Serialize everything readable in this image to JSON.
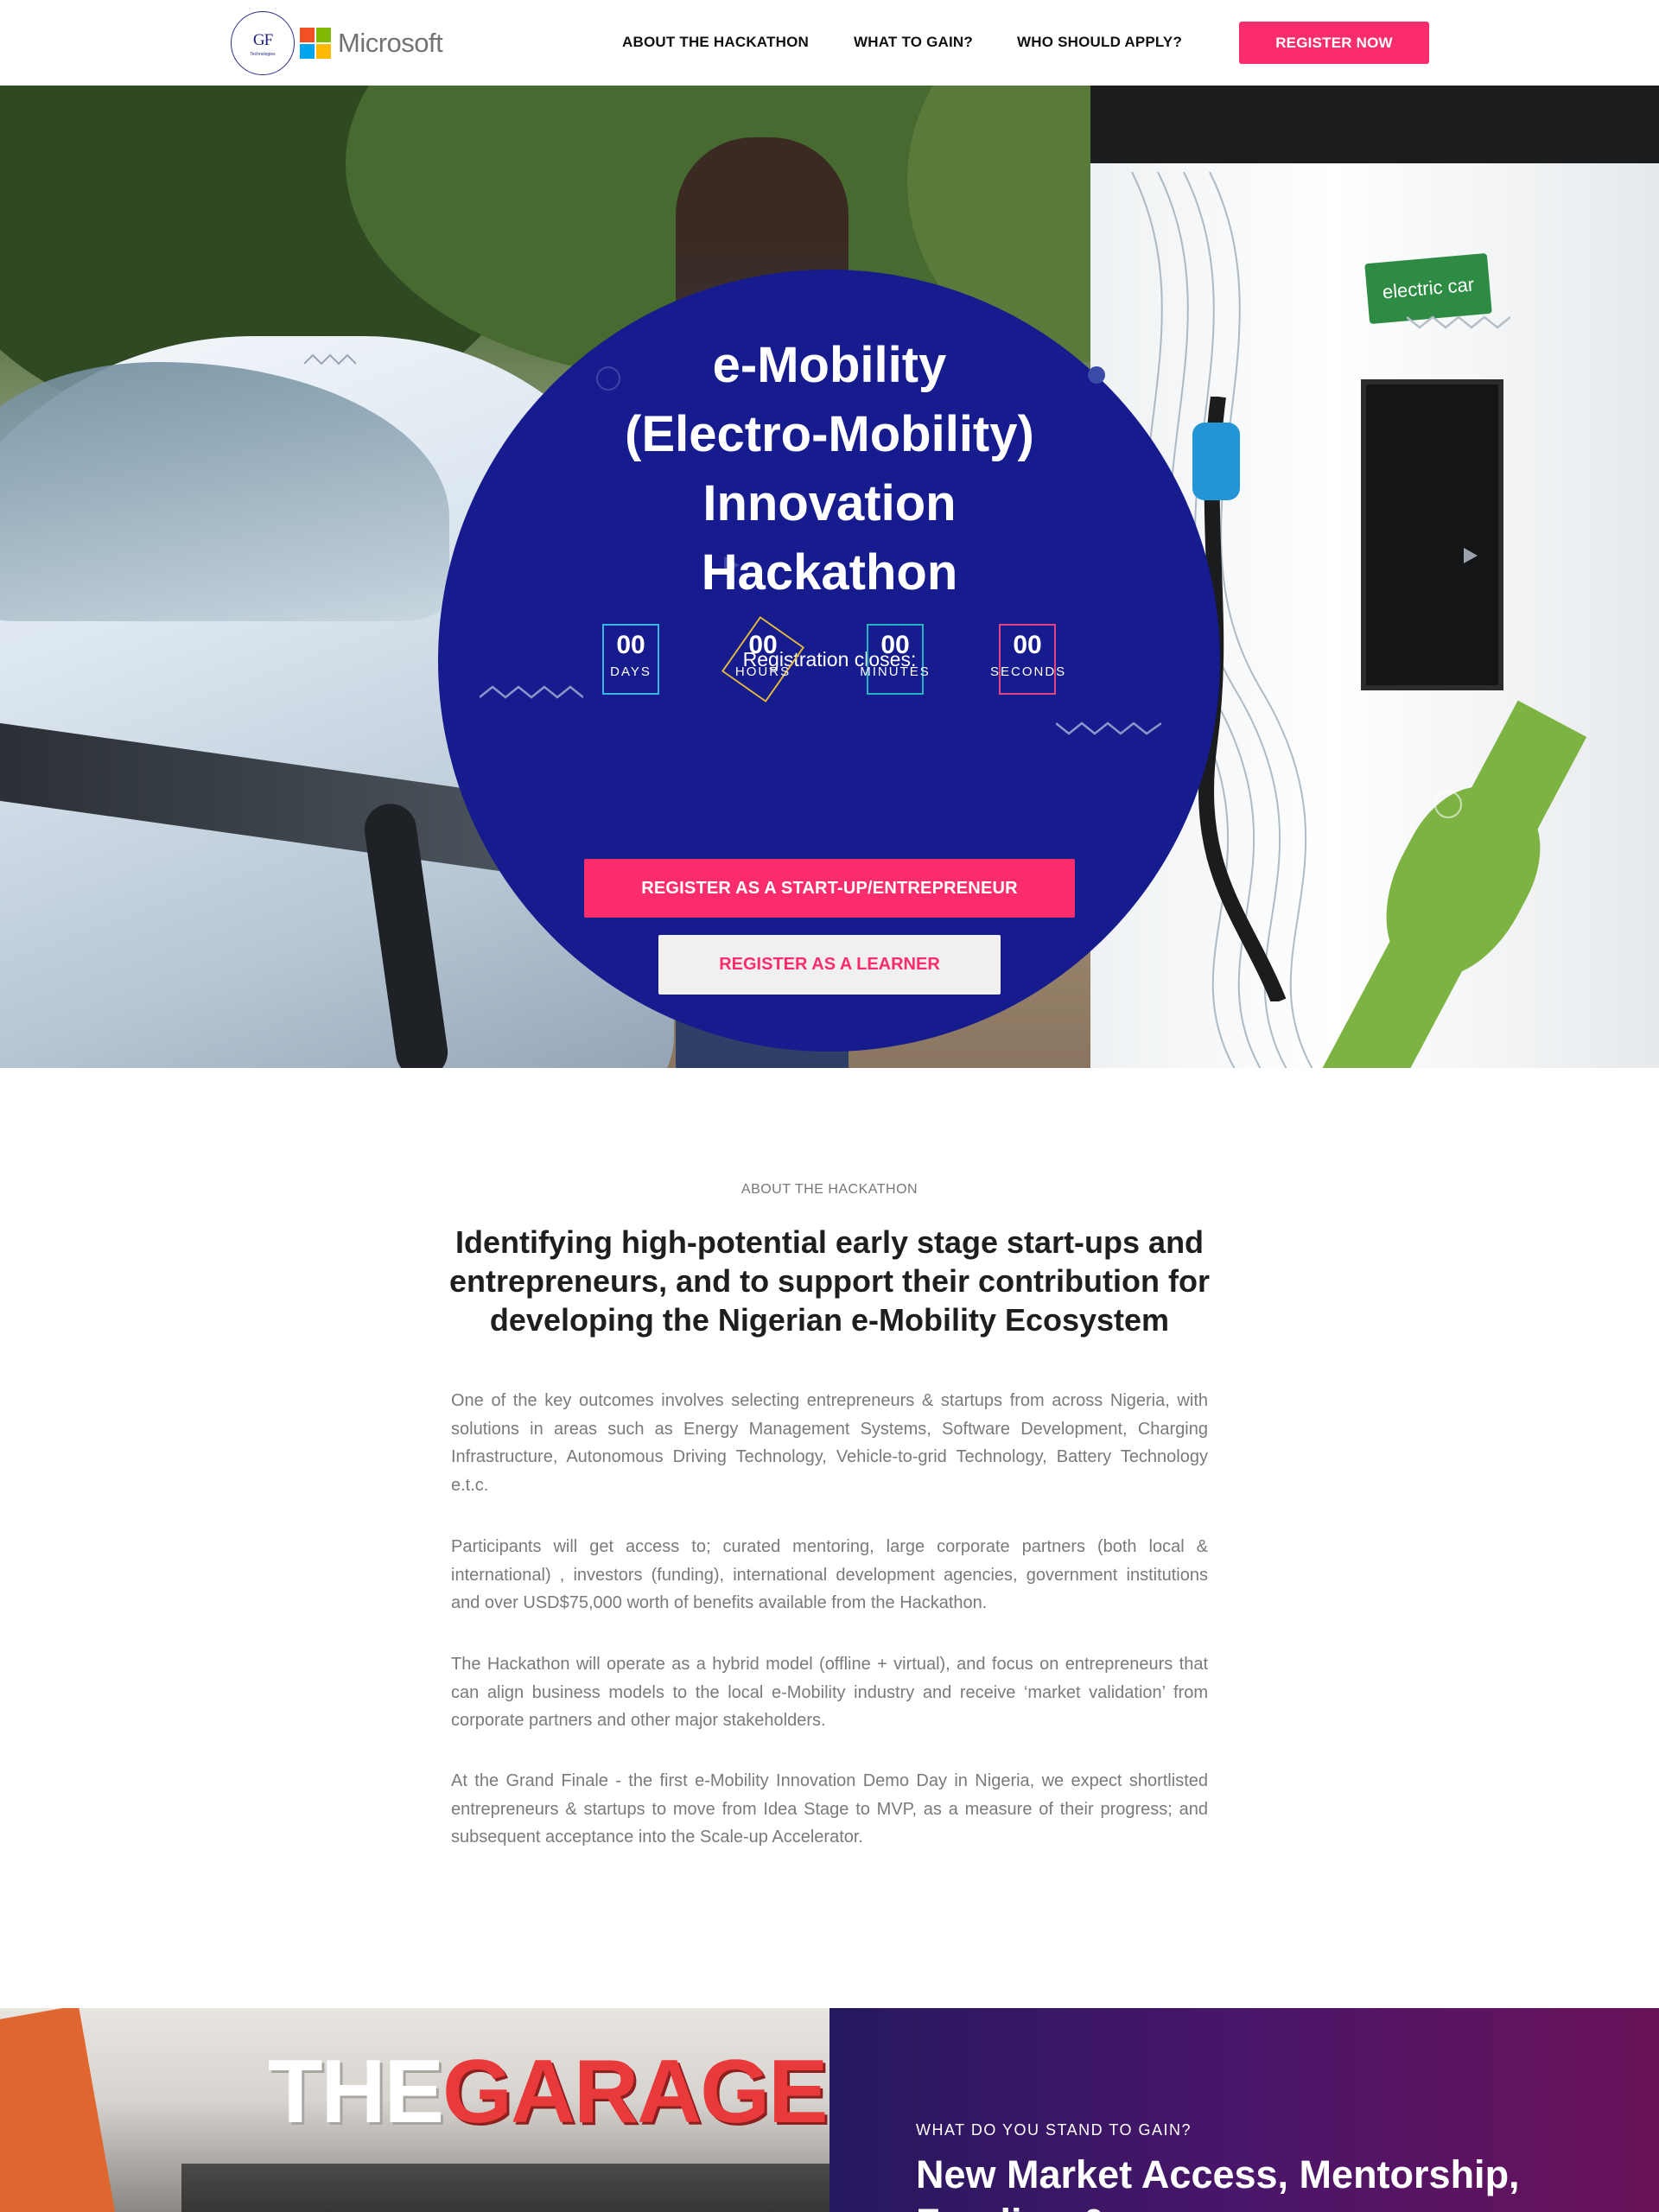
{
  "header": {
    "gf_logo_text": "GF",
    "gf_logo_sub": "Technologies",
    "microsoft_logo_text": "Microsoft",
    "nav": [
      "ABOUT THE HACKATHON",
      "WHAT TO GAIN?",
      "WHO SHOULD APPLY?"
    ],
    "register_now_label": "REGISTER NOW ",
    "accent_color": "#fb2c6b"
  },
  "hero": {
    "title_lines": [
      "e-Mobility",
      "(Electro-Mobility)",
      "Innovation",
      "Hackathon"
    ],
    "registration_label": "Registration closes:",
    "countdown": [
      {
        "value": "00",
        "label": "DAYS",
        "color": "#36b6e0"
      },
      {
        "value": "00",
        "label": "HOURS",
        "color": "#e5b93a"
      },
      {
        "value": "00",
        "label": "MINUTES",
        "color": "#22b2c0"
      },
      {
        "value": "00",
        "label": "SECONDS",
        "color": "#e3467f"
      }
    ],
    "btn_startup": "REGISTER AS A START-UP/ENTREPRENEUR",
    "btn_learner": "REGISTER AS A LEARNER",
    "background_image_badge": "electric car",
    "circle_color": "#161b8e"
  },
  "about": {
    "eyebrow": "ABOUT THE HACKATHON",
    "heading": "Identifying high-potential early stage start-ups and entrepreneurs, and to support their contribution for developing the Nigerian e-Mobility Ecosystem",
    "paragraphs": [
      "One of the key outcomes involves selecting entrepreneurs & startups from across Nigeria, with solutions in areas such as Energy Management Systems, Software Development, Charging Infrastructure, Autonomous Driving Technology, Vehicle-to-grid Technology, Battery Technology e.t.c.",
      "Participants will get access to; curated mentoring, large corporate partners (both local & international) , investors (funding), international development agencies, government institutions and over USD$75,000 worth of benefits available from the Hackathon.",
      "The Hackathon will operate as a hybrid model (offline + virtual), and focus on entrepreneurs that can align business models to the local e-Mobility industry and receive ‘market validation’ from corporate partners and other major stakeholders.",
      "At the Grand Finale - the first e-Mobility Innovation Demo Day in Nigeria, we expect shortlisted entrepreneurs & startups to move from Idea Stage to MVP, as a measure of their progress; and subsequent acceptance into the Scale-up Accelerator."
    ]
  },
  "gain": {
    "sign_the": "THE",
    "sign_garage": "GARAGE",
    "eyebrow": "WHAT DO YOU STAND TO GAIN?",
    "heading": "New Market Access, Mentorship, Funding &"
  }
}
